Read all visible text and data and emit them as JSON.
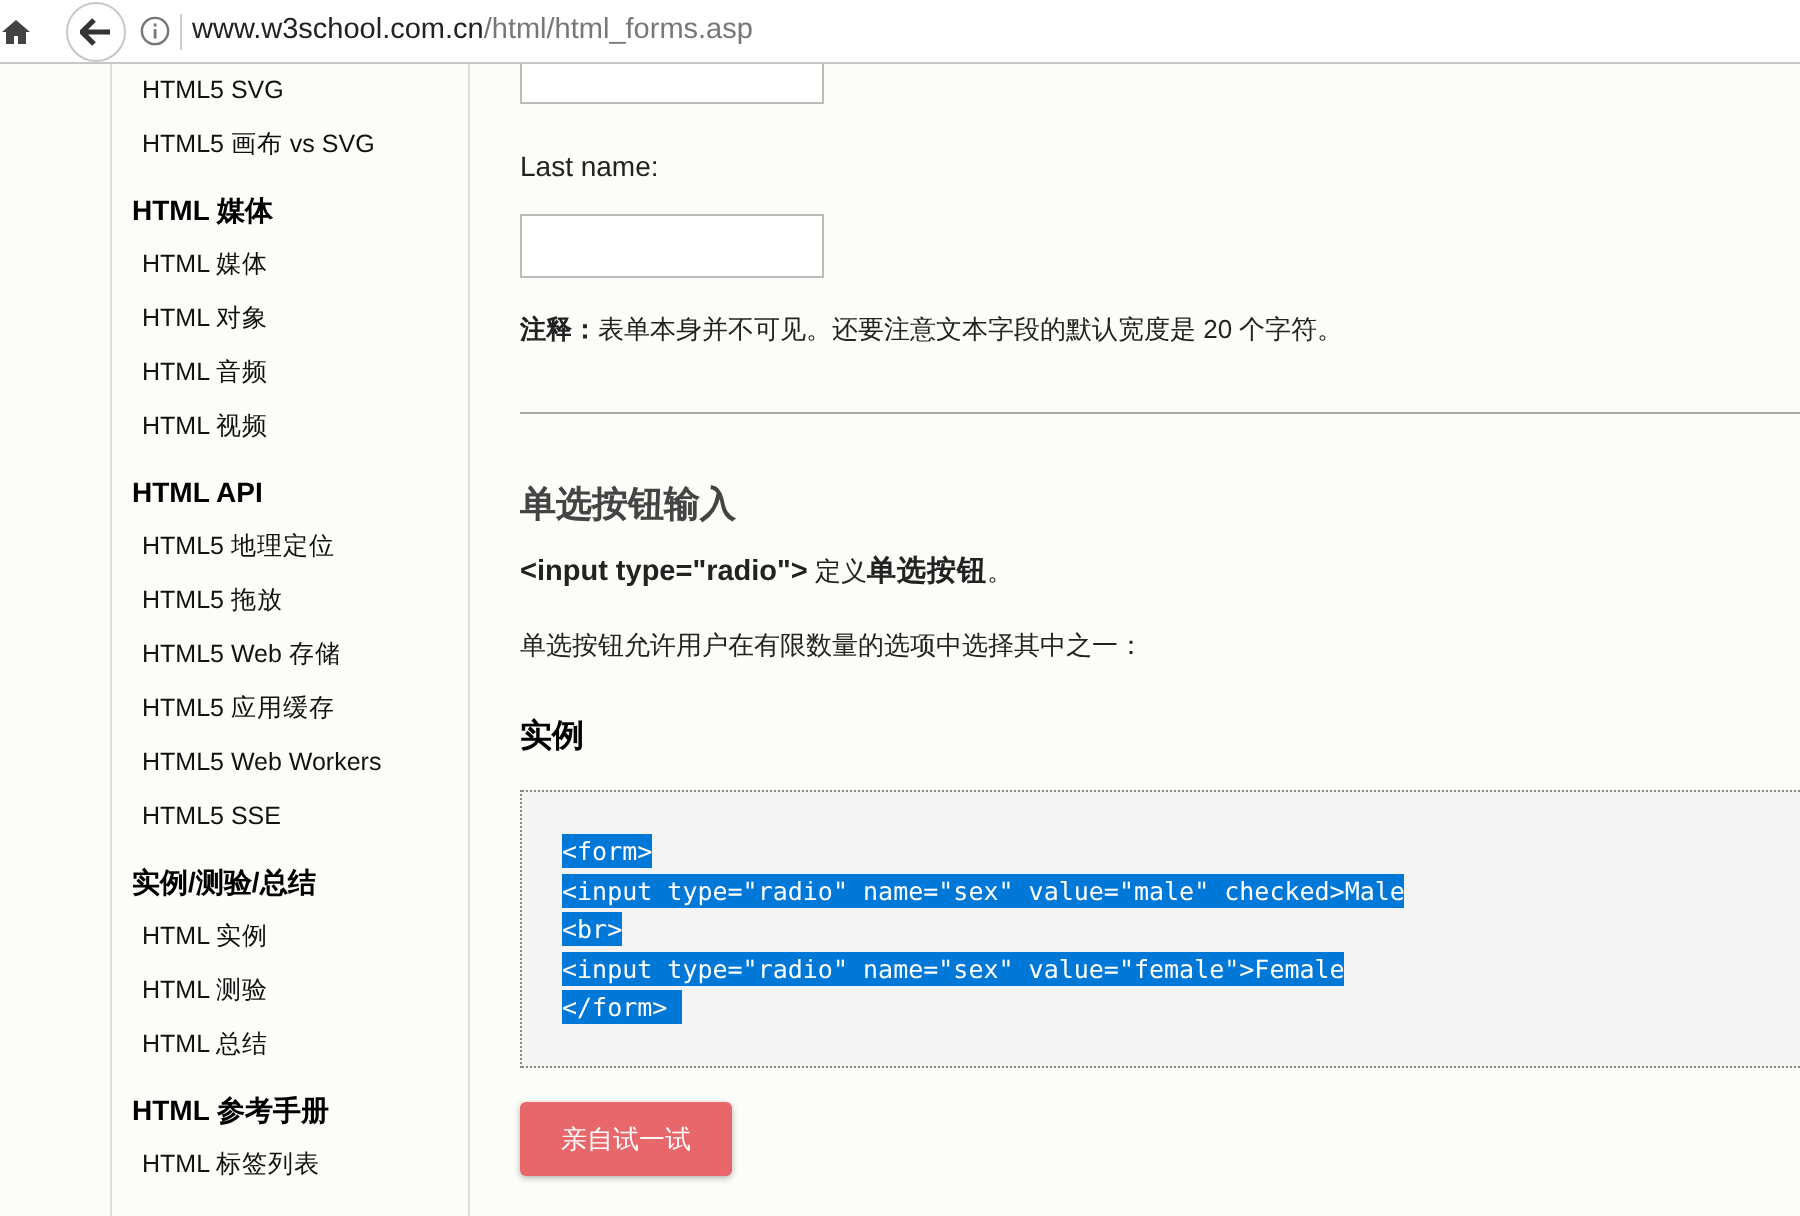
{
  "address_bar": {
    "host": "www.w3school.com.cn",
    "path": "/html/html_forms.asp"
  },
  "sidebar": {
    "groups": [
      {
        "items": [
          "HTML5 SVG",
          "HTML5 画布 vs SVG"
        ]
      },
      {
        "heading": "HTML 媒体",
        "items": [
          "HTML 媒体",
          "HTML 对象",
          "HTML 音频",
          "HTML 视频"
        ]
      },
      {
        "heading": "HTML API",
        "items": [
          "HTML5 地理定位",
          "HTML5 拖放",
          "HTML5 Web 存储",
          "HTML5 应用缓存",
          "HTML5 Web Workers",
          "HTML5 SSE"
        ]
      },
      {
        "heading": "实例/测验/总结",
        "items": [
          "HTML 实例",
          "HTML 测验",
          "HTML 总结"
        ]
      },
      {
        "heading": "HTML 参考手册",
        "items": [
          "HTML 标签列表"
        ]
      }
    ]
  },
  "content": {
    "field_label": "Last name:",
    "note": "**注释：**表单本身并不可见。还要注意文本字段的默认宽度是 20 个字符。",
    "section_title": "单选按钮输入",
    "definition": "**<input type=\"radio\">** 定义**单选按钮**。",
    "paragraph": "单选按钮允许用户在有限数量的选项中选择其中之一：",
    "example_title": "实例",
    "code_lines": [
      {
        "text": "<form>",
        "selected": true
      },
      {
        "text": "<input type=\"radio\" name=\"sex\" value=\"male\" checked>Male",
        "selected": true
      },
      {
        "text": "<br>",
        "selected": true
      },
      {
        "text": "<input type=\"radio\" name=\"sex\" value=\"female\">Female",
        "selected": true
      },
      {
        "text": "</form> ",
        "selected": true
      }
    ],
    "try_button": "亲自试一试"
  }
}
